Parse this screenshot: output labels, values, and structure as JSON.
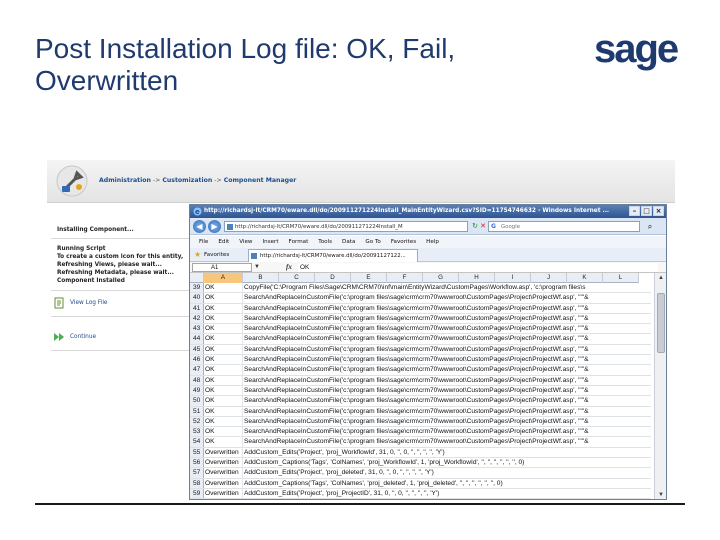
{
  "slide": {
    "title": "Post Installation Log file: OK, Fail, Overwritten",
    "logo_text": "sage"
  },
  "crm": {
    "breadcrumb": [
      "Administration",
      "Customization",
      "Component Manager"
    ],
    "steps_bold": [
      "Installing Component...",
      "Running Script"
    ],
    "steps_messages": [
      "To create a custom icon for this entity,",
      "Refreshing Views, please wait...",
      "Refreshing Metadata, please wait...",
      "Component Installed"
    ],
    "actions": {
      "view_log": "View Log File",
      "continue": "Continue"
    }
  },
  "ie": {
    "title": "http://richardsj-lt/CRM70/eware.dll/do/200911271224Install_MainEntityWizard.csv?SID=11754746632 - Windows Internet ...",
    "address": "http://richardsj-lt/CRM70/eware.dll/do/200911271224Install_M",
    "search_placeholder": "Google",
    "menu": [
      "File",
      "Edit",
      "View",
      "Insert",
      "Format",
      "Tools",
      "Data",
      "Go To",
      "Favorites",
      "Help"
    ],
    "favorites_label": "Favorites",
    "tab_label": "http://richardsj-lt/CRM70/eware.dll/do/20091127122...",
    "window_buttons": [
      "–",
      "□",
      "×"
    ]
  },
  "excel": {
    "name_box": "A1",
    "formula_value": "OK",
    "columns": [
      "A",
      "B",
      "C",
      "D",
      "E",
      "F",
      "G",
      "H",
      "I",
      "J",
      "K",
      "L"
    ],
    "rows": [
      {
        "n": "39",
        "status": "OK",
        "text": "CopyFile('C:\\Program Files\\Sage\\CRM\\CRM70\\inf\\main\\EntityWizard\\CustomPages\\Workflow.asp', 'c:\\program files\\s"
      },
      {
        "n": "40",
        "status": "OK",
        "text": "SearchAndReplaceInCustomFile('c:\\program files\\sage\\crm\\crm70\\wwwroot\\CustomPages\\Project\\ProjectWf.asp', '\"\"&"
      },
      {
        "n": "41",
        "status": "OK",
        "text": "SearchAndReplaceInCustomFile('c:\\program files\\sage\\crm\\crm70\\wwwroot\\CustomPages\\Project\\ProjectWf.asp', '\"\"&"
      },
      {
        "n": "42",
        "status": "OK",
        "text": "SearchAndReplaceInCustomFile('c:\\program files\\sage\\crm\\crm70\\wwwroot\\CustomPages\\Project\\ProjectWf.asp', '\"\"&"
      },
      {
        "n": "43",
        "status": "OK",
        "text": "SearchAndReplaceInCustomFile('c:\\program files\\sage\\crm\\crm70\\wwwroot\\CustomPages\\Project\\ProjectWf.asp', '\"\"&"
      },
      {
        "n": "44",
        "status": "OK",
        "text": "SearchAndReplaceInCustomFile('c:\\program files\\sage\\crm\\crm70\\wwwroot\\CustomPages\\Project\\ProjectWf.asp', '\"\"&"
      },
      {
        "n": "45",
        "status": "OK",
        "text": "SearchAndReplaceInCustomFile('c:\\program files\\sage\\crm\\crm70\\wwwroot\\CustomPages\\Project\\ProjectWf.asp', '\"\"&"
      },
      {
        "n": "46",
        "status": "OK",
        "text": "SearchAndReplaceInCustomFile('c:\\program files\\sage\\crm\\crm70\\wwwroot\\CustomPages\\Project\\ProjectWf.asp', '\"\"&"
      },
      {
        "n": "47",
        "status": "OK",
        "text": "SearchAndReplaceInCustomFile('c:\\program files\\sage\\crm\\crm70\\wwwroot\\CustomPages\\Project\\ProjectWf.asp', '\"\"&"
      },
      {
        "n": "48",
        "status": "OK",
        "text": "SearchAndReplaceInCustomFile('c:\\program files\\sage\\crm\\crm70\\wwwroot\\CustomPages\\Project\\ProjectWf.asp', '\"\"&"
      },
      {
        "n": "49",
        "status": "OK",
        "text": "SearchAndReplaceInCustomFile('c:\\program files\\sage\\crm\\crm70\\wwwroot\\CustomPages\\Project\\ProjectWf.asp', '\"\"&"
      },
      {
        "n": "50",
        "status": "OK",
        "text": "SearchAndReplaceInCustomFile('c:\\program files\\sage\\crm\\crm70\\wwwroot\\CustomPages\\Project\\ProjectWf.asp', '\"\"&"
      },
      {
        "n": "51",
        "status": "OK",
        "text": "SearchAndReplaceInCustomFile('c:\\program files\\sage\\crm\\crm70\\wwwroot\\CustomPages\\Project\\ProjectWf.asp', '\"\"&"
      },
      {
        "n": "52",
        "status": "OK",
        "text": "SearchAndReplaceInCustomFile('c:\\program files\\sage\\crm\\crm70\\wwwroot\\CustomPages\\Project\\ProjectWf.asp', '\"\"&"
      },
      {
        "n": "53",
        "status": "OK",
        "text": "SearchAndReplaceInCustomFile('c:\\program files\\sage\\crm\\crm70\\wwwroot\\CustomPages\\Project\\ProjectWf.asp', '\"\"&"
      },
      {
        "n": "54",
        "status": "OK",
        "text": "SearchAndReplaceInCustomFile('c:\\program files\\sage\\crm\\crm70\\wwwroot\\CustomPages\\Project\\ProjectWf.asp', '\"\"&"
      },
      {
        "n": "55",
        "status": "Overwritten",
        "text": "AddCustom_Edits('Project', 'proj_WorkflowId', 31, 0, '', 0, '', '', '', '', 'Y')"
      },
      {
        "n": "56",
        "status": "Overwritten",
        "text": "AddCustom_Captions('Tags', 'ColNames', 'proj_WorkflowId', 1, 'proj_WorkflowId', '', '', '', '', '', '', 0)"
      },
      {
        "n": "57",
        "status": "Overwritten",
        "text": "AddCustom_Edits('Project', 'proj_deleted', 31, 0, '', 0, '', '', '', '', 'Y')"
      },
      {
        "n": "58",
        "status": "Overwritten",
        "text": "AddCustom_Captions('Tags', 'ColNames', 'proj_deleted', 1, 'proj_deleted', '', '', '', '', '', '', 0)"
      },
      {
        "n": "59",
        "status": "Overwritten",
        "text": "AddCustom_Edits('Project', 'proj_ProjectID', 31, 0, '', 0, '', '', '', '', 'Y')"
      }
    ]
  },
  "colors": {
    "title": "#1f3a6e",
    "logo": "#1f3a6e",
    "ie_title": "#2e5592"
  }
}
